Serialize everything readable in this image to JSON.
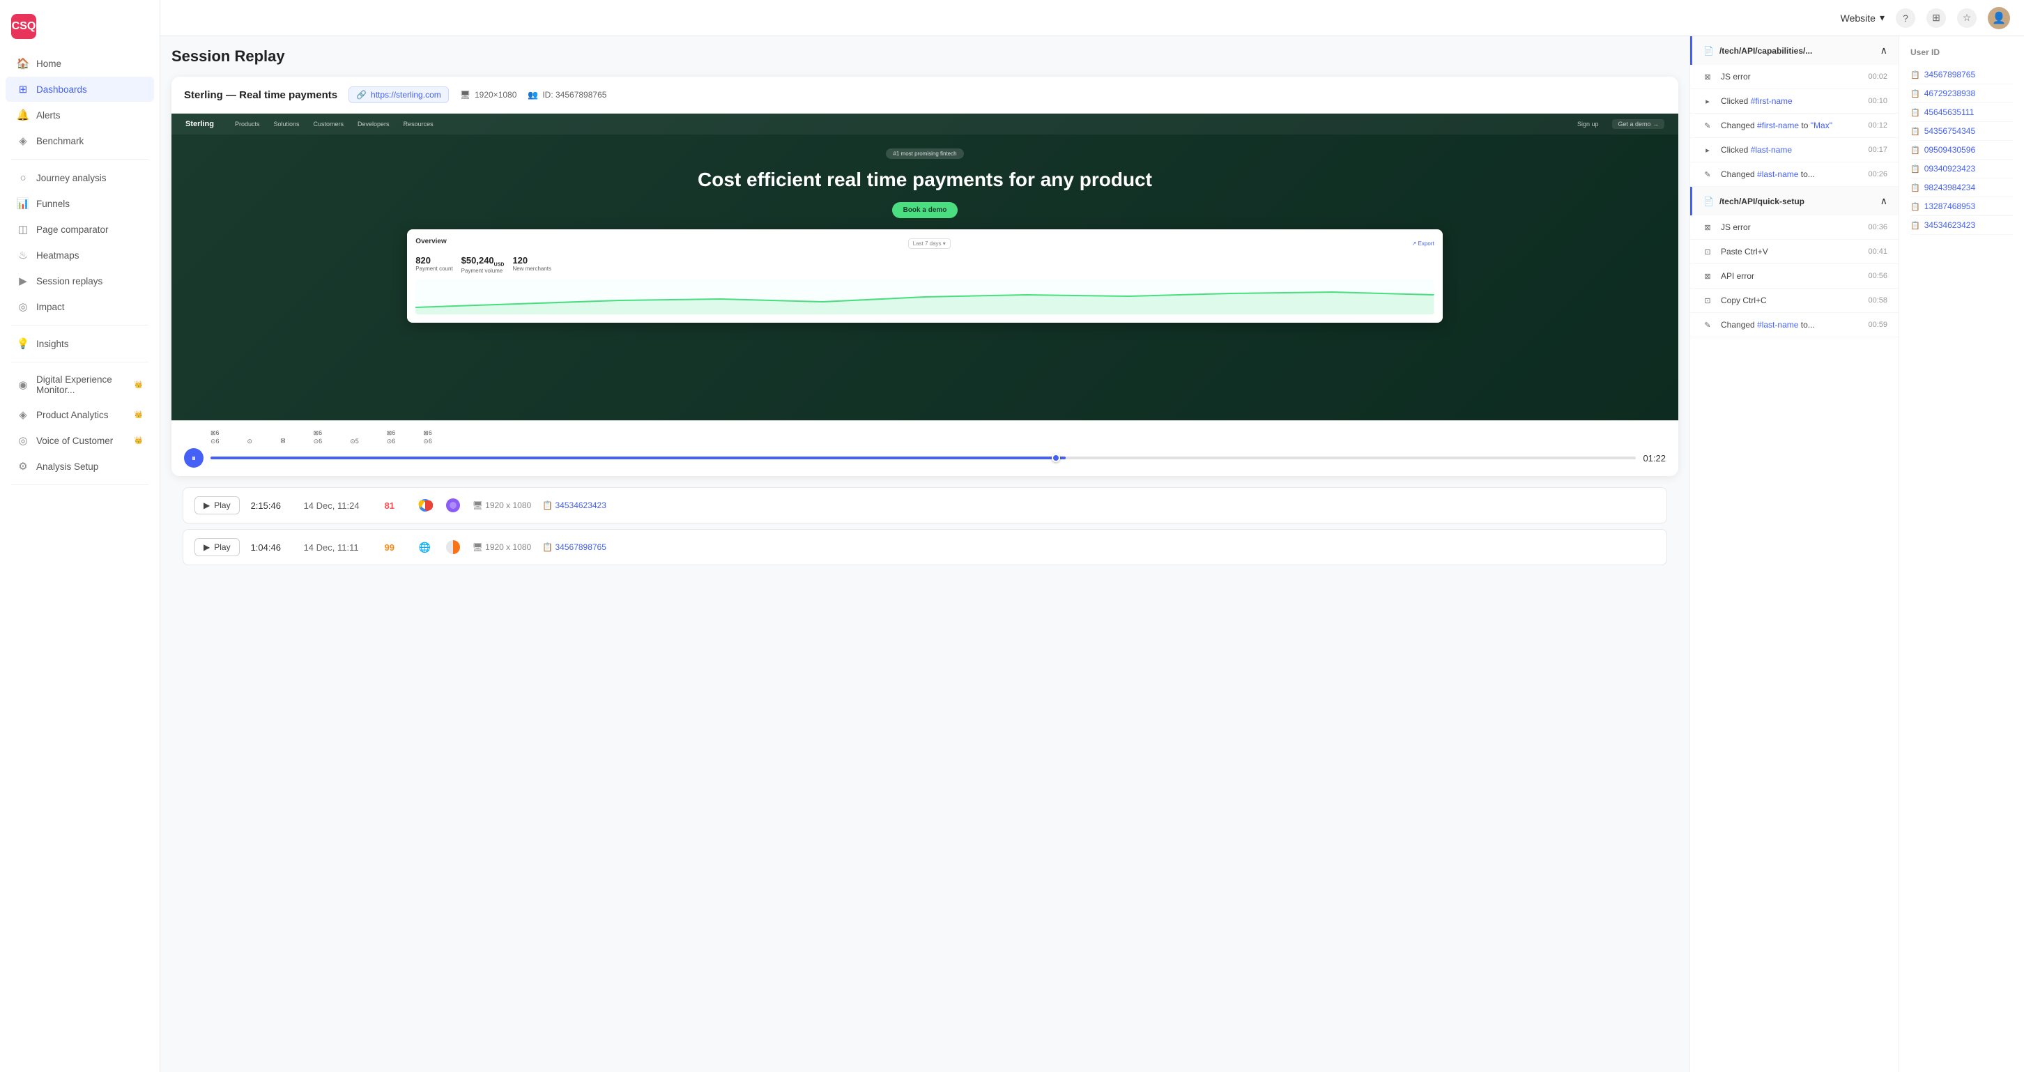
{
  "app": {
    "logo": "CSQ",
    "logo_bg": "#e8335a"
  },
  "topbar": {
    "website_label": "Website",
    "website_dropdown": true
  },
  "sidebar": {
    "items": [
      {
        "id": "home",
        "label": "Home",
        "icon": "🏠",
        "active": false
      },
      {
        "id": "dashboards",
        "label": "Dashboards",
        "icon": "⊞",
        "active": true
      },
      {
        "id": "alerts",
        "label": "Alerts",
        "icon": "🔔",
        "active": false
      },
      {
        "id": "benchmark",
        "label": "Benchmark",
        "icon": "◈",
        "active": false
      },
      {
        "id": "journey-analysis",
        "label": "Journey analysis",
        "icon": "○",
        "active": false
      },
      {
        "id": "funnels",
        "label": "Funnels",
        "icon": "📊",
        "active": false
      },
      {
        "id": "page-comparator",
        "label": "Page comparator",
        "icon": "◫",
        "active": false
      },
      {
        "id": "heatmaps",
        "label": "Heatmaps",
        "icon": "♨",
        "active": false
      },
      {
        "id": "session-replays",
        "label": "Session replays",
        "icon": "▶",
        "active": false
      },
      {
        "id": "impact",
        "label": "Impact",
        "icon": "◎",
        "active": false
      },
      {
        "id": "insights",
        "label": "Insights",
        "icon": "💡",
        "active": false
      },
      {
        "id": "digital-experience",
        "label": "Digital Experience Monitor...",
        "icon": "◉",
        "active": false,
        "crown": true
      },
      {
        "id": "product-analytics",
        "label": "Product Analytics",
        "icon": "◈",
        "active": false,
        "crown": true
      },
      {
        "id": "voice-of-customer",
        "label": "Voice of Customer",
        "icon": "◎",
        "active": false,
        "crown": true
      },
      {
        "id": "analysis-setup",
        "label": "Analysis Setup",
        "icon": "⚙",
        "active": false
      }
    ]
  },
  "page": {
    "title": "Session Replay"
  },
  "player": {
    "title": "Sterling — Real time payments",
    "url": "https://sterling.com",
    "resolution": "1920×1080",
    "user_id_label": "ID: 34567898765",
    "site_badge": "#1 most promising fintech",
    "site_headline": "Cost efficient real time payments for any product",
    "site_cta": "Book a demo",
    "site_nav_logo": "Sterling",
    "site_nav_items": [
      "Products",
      "Solutions",
      "Customers",
      "Developers",
      "Resources",
      "Sign up",
      "Get a demo"
    ],
    "dashboard_title": "Overview",
    "dashboard_period": "Last 7 days",
    "dashboard_export": "Export",
    "metrics": [
      {
        "label": "Payment count",
        "value": "820"
      },
      {
        "label": "Payment volume",
        "value": "$50,240 USD"
      },
      {
        "label": "New merchants",
        "value": "120"
      }
    ],
    "time": "01:22",
    "timeline_markers": [
      {
        "count": "⊠6",
        "pin": "⊙6"
      },
      {
        "count": "",
        "pin": "⊙"
      },
      {
        "count": "⊠",
        "pin": ""
      },
      {
        "count": "⊠6",
        "pin": "⊙6"
      },
      {
        "count": "",
        "pin": "⊙5"
      },
      {
        "count": "⊠6",
        "pin": "⊙6"
      },
      {
        "count": "⊠6",
        "pin": "⊙6"
      }
    ]
  },
  "events": {
    "sections": [
      {
        "id": "tech-api-capabilities",
        "title": "/tech/API/capabilities/...",
        "expanded": true,
        "items": [
          {
            "type": "js-error",
            "icon": "⊠",
            "desc": "JS error",
            "time": "00:02"
          },
          {
            "type": "click",
            "icon": "▸",
            "desc": "Clicked #first-name",
            "link": "#first-name",
            "time": "00:10"
          },
          {
            "type": "change",
            "icon": "✎",
            "desc_pre": "Changed ",
            "link": "#first-name",
            "desc_mid": " to ",
            "link2": "\"Max\"",
            "time": "00:12"
          },
          {
            "type": "click",
            "icon": "▸",
            "desc": "Clicked #last-name",
            "link": "#last-name",
            "time": "00:17"
          },
          {
            "type": "change",
            "icon": "✎",
            "desc_pre": "Changed ",
            "link": "#last-name",
            "desc_mid": " to...",
            "time": "00:26"
          }
        ]
      },
      {
        "id": "tech-api-quick-setup",
        "title": "/tech/API/quick-setup",
        "expanded": true,
        "items": [
          {
            "type": "js-error",
            "icon": "⊠",
            "desc": "JS error",
            "time": "00:36"
          },
          {
            "type": "paste",
            "icon": "⊡",
            "desc": "Paste Ctrl+V",
            "time": "00:41"
          },
          {
            "type": "api-error",
            "icon": "⊠",
            "desc": "API error",
            "time": "00:56"
          },
          {
            "type": "copy",
            "icon": "⊡",
            "desc": "Copy Ctrl+C",
            "time": "00:58"
          },
          {
            "type": "change",
            "icon": "✎",
            "desc_pre": "Changed ",
            "link": "#last-name",
            "desc_mid": " to...",
            "time": "00:59"
          }
        ]
      }
    ]
  },
  "userid_panel": {
    "title": "User ID",
    "items": [
      "34567898765",
      "46729238938",
      "45645635111",
      "54356754345",
      "09509430596",
      "09340923423",
      "98243984234",
      "13287468953",
      "34534623423"
    ]
  },
  "session_list": {
    "rows": [
      {
        "duration": "2:15:46",
        "date": "14 Dec, 11:24",
        "errors": "81",
        "errors_class": "high",
        "browser": "chrome",
        "os": "firefox-color",
        "resolution": "1920 x 1080",
        "userid": "34534623423"
      },
      {
        "duration": "1:04:46",
        "date": "14 Dec, 11:11",
        "errors": "99",
        "errors_class": "medium",
        "browser": "arc",
        "os": "half-color",
        "resolution": "1920 x 1080",
        "userid": "34567898765"
      }
    ],
    "play_label": "Play"
  }
}
